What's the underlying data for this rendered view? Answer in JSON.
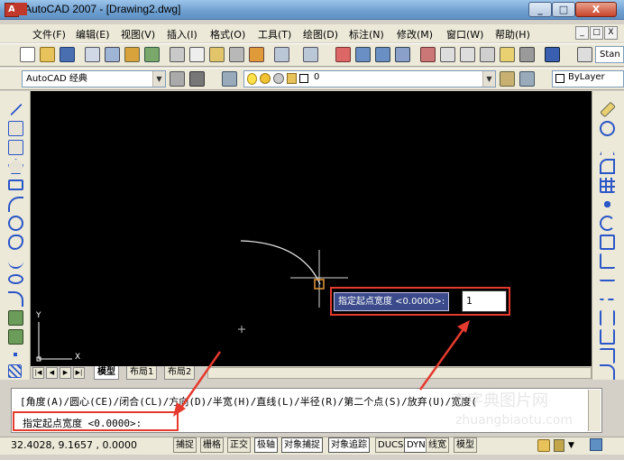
{
  "window": {
    "title": "AutoCAD 2007 - [Drawing2.dwg]",
    "app_icon_glyph": "A",
    "controls": {
      "minimize": "_",
      "maximize": "□",
      "close": "X"
    }
  },
  "menu": {
    "items": [
      "文件(F)",
      "编辑(E)",
      "视图(V)",
      "插入(I)",
      "格式(O)",
      "工具(T)",
      "绘图(D)",
      "标注(N)",
      "修改(M)",
      "窗口(W)",
      "帮助(H)"
    ],
    "mdi_controls": [
      "_",
      "□",
      "X"
    ]
  },
  "toolbars": {
    "workspace_combo": "AutoCAD 经典",
    "layer_combo": "0",
    "text_style_combo": "Stan",
    "bylayer_combo": "ByLayer",
    "combo_arrow": "▼"
  },
  "canvas": {
    "ucs_x_label": "X",
    "ucs_y_label": "Y"
  },
  "layout_tabs": {
    "nav_buttons": [
      "|◀",
      "◀",
      "▶",
      "▶|"
    ],
    "tabs": [
      "模型",
      "布局1",
      "布局2"
    ]
  },
  "command_line": {
    "history": "[角度(A)/圆心(CE)/闭合(CL)/方向(D)/半宽(H)/直线(L)/半径(R)/第二个点(S)/放弃(U)/宽度(",
    "prompt": "指定起点宽度 <0.0000>:"
  },
  "dynamic_input": {
    "label": "指定起点宽度 <0.0000>:",
    "value": "1"
  },
  "status_bar": {
    "coordinates": "32.4028, 9.1657 , 0.0000",
    "buttons": [
      {
        "label": "捕捉",
        "on": false
      },
      {
        "label": "栅格",
        "on": false
      },
      {
        "label": "正交",
        "on": false
      },
      {
        "label": "极轴",
        "on": true
      },
      {
        "label": "对象捕捉",
        "on": true
      },
      {
        "label": "对象追踪",
        "on": true
      },
      {
        "label": "DUCS",
        "on": false
      },
      {
        "label": "DYN",
        "on": true
      },
      {
        "label": "线宽",
        "on": false
      },
      {
        "label": "模型",
        "on": false
      }
    ]
  },
  "watermark": {
    "text": "查字典图片网",
    "url": "zhuangbiaotu.com"
  },
  "annotation_color": "#e53a2e"
}
